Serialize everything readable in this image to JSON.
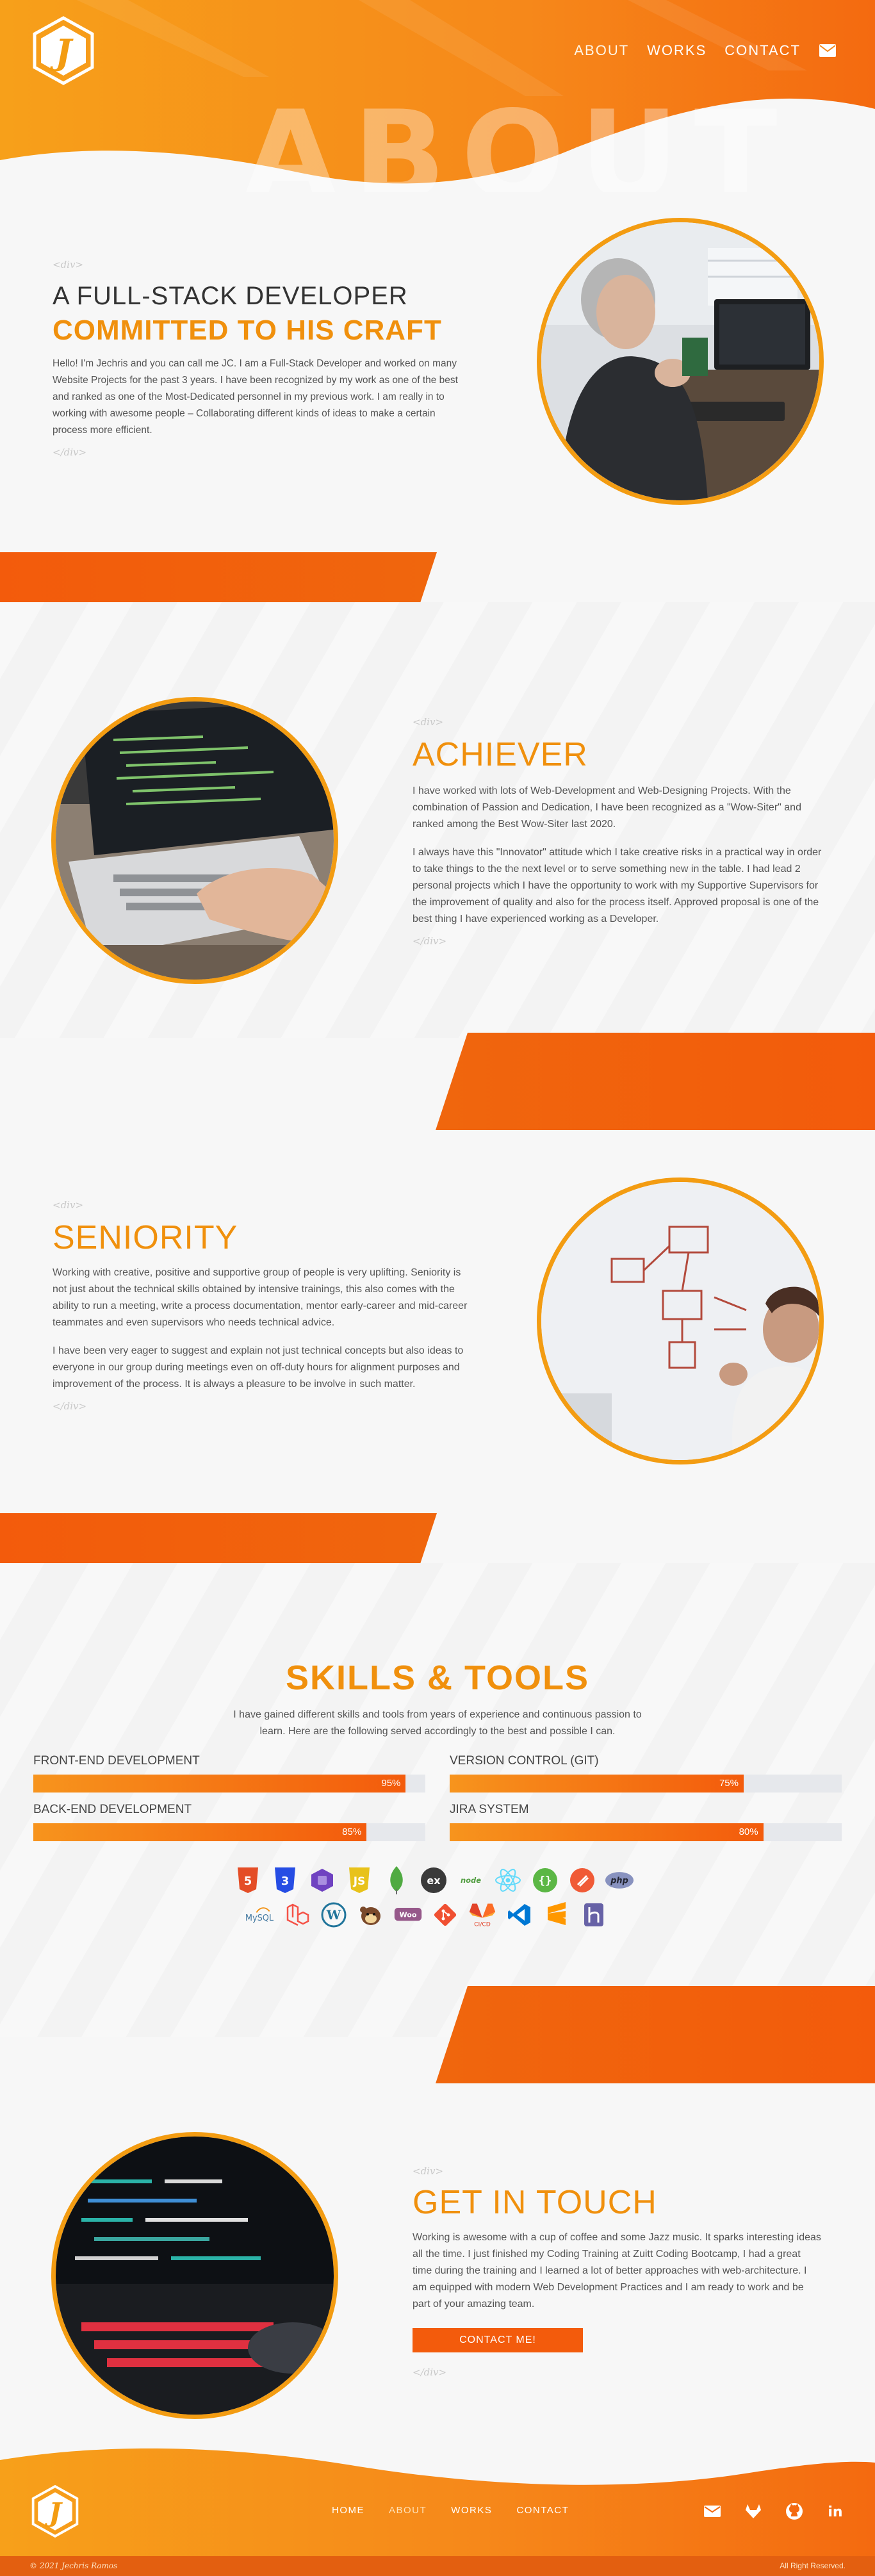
{
  "colors": {
    "accent": "#f0900d",
    "accent_dark": "#f35b0c",
    "ring": "#f39c12",
    "bg": "#f7f7f7"
  },
  "header": {
    "logo_letter": "J",
    "nav": [
      {
        "label": "ABOUT",
        "active": true
      },
      {
        "label": "WORKS",
        "active": false
      },
      {
        "label": "CONTACT",
        "active": false
      }
    ],
    "mail_icon": "envelope-icon",
    "hero_word": "ABOUT"
  },
  "intro": {
    "open_tag": "<div>",
    "close_tag": "</div>",
    "title_thin": "A FULL-STACK DEVELOPER",
    "title_bold": "COMMITTED TO HIS CRAFT",
    "paragraph": "Hello! I'm Jechris and you can call me JC. I am a Full-Stack Developer and worked on many Website Projects for the past 3 years. I have been recognized by my work as one of the best and ranked as one of the Most-Dedicated personnel in my previous work. I am really in to working with awesome people – Collaborating different kinds of ideas to make a certain process more efficient."
  },
  "achiever": {
    "open_tag": "<div>",
    "close_tag": "</div>",
    "title": "ACHIEVER",
    "paragraphs": [
      "I have worked with lots of Web-Development and Web-Designing Projects. With the combination of Passion and Dedication, I have been recognized as a \"Wow-Siter\" and ranked among the Best Wow-Siter last 2020.",
      "I always have this \"Innovator\" attitude which I take creative risks in a practical way in order to take things to the the next level or to serve something new in the table. I had lead 2 personal projects which I have the opportunity to work with my Supportive Supervisors for the improvement of quality and also for the process itself. Approved proposal is one of the best thing I have experienced working as a Developer."
    ]
  },
  "seniority": {
    "open_tag": "<div>",
    "close_tag": "</div>",
    "title": "SENIORITY",
    "paragraphs": [
      "Working with creative, positive and supportive group of people is very uplifting. Seniority is not just about the technical skills obtained by intensive trainings, this also comes with the ability to run a meeting, write a process documentation, mentor early-career and mid-career teammates and even supervisors who needs technical advice.",
      "I have been very eager to suggest and explain not just technical concepts but also ideas to everyone in our group during meetings even on off-duty hours for alignment purposes and improvement of the process. It is always a pleasure to be involve in such matter."
    ]
  },
  "skills": {
    "title": "SKILLS & TOOLS",
    "description": "I have gained different skills and tools from years of experience and continuous passion to learn. Here are the following served accordingly to the best and possible I can.",
    "bars": [
      {
        "label": "FRONT-END DEVELOPMENT",
        "percent": 95,
        "percent_label": "95%"
      },
      {
        "label": "VERSION CONTROL (GIT)",
        "percent": 75,
        "percent_label": "75%"
      },
      {
        "label": "BACK-END DEVELOPMENT",
        "percent": 85,
        "percent_label": "85%"
      },
      {
        "label": "JIRA SYSTEM",
        "percent": 80,
        "percent_label": "80%"
      }
    ],
    "icons_row1": [
      "html5-icon",
      "css3-icon",
      "bootstrap-icon",
      "javascript-icon",
      "mongodb-icon",
      "express-icon",
      "nodejs-icon",
      "react-icon",
      "handlebars-icon",
      "swiper-icon",
      "php-icon"
    ],
    "icons_row2": [
      "mysql-icon",
      "laravel-icon",
      "wordpress-icon",
      "mailchimp-icon",
      "woocommerce-icon",
      "git-icon",
      "gitlab-cicd-icon",
      "vscode-icon",
      "sublime-icon",
      "heroku-icon"
    ],
    "icon_texts": {
      "express": "ex",
      "nodejs": "node",
      "php": "php",
      "mysql": "MySQL",
      "woo": "Woo",
      "cicd": "CI/CD"
    }
  },
  "contact": {
    "open_tag": "<div>",
    "close_tag": "</div>",
    "title": "GET IN TOUCH",
    "paragraph": "Working is awesome with a cup of coffee and some Jazz music. It sparks interesting ideas all the time. I just finished my Coding Training at Zuitt Coding Bootcamp, I had a great time during the training and I learned a lot of better approaches with web-architecture. I am equipped with modern Web Development Practices and I am ready to work and be part of your amazing team.",
    "button": "CONTACT ME!"
  },
  "footer": {
    "logo_letter": "J",
    "nav": [
      {
        "label": "HOME",
        "active": false
      },
      {
        "label": "ABOUT",
        "active": true
      },
      {
        "label": "WORKS",
        "active": false
      },
      {
        "label": "CONTACT",
        "active": false
      }
    ],
    "social_icons": [
      "envelope-icon",
      "gitlab-icon",
      "github-icon",
      "linkedin-icon"
    ],
    "linkedin_text": "in",
    "copyright": "© 2021 Jechris Ramos",
    "rights": "All Right Reserved."
  }
}
